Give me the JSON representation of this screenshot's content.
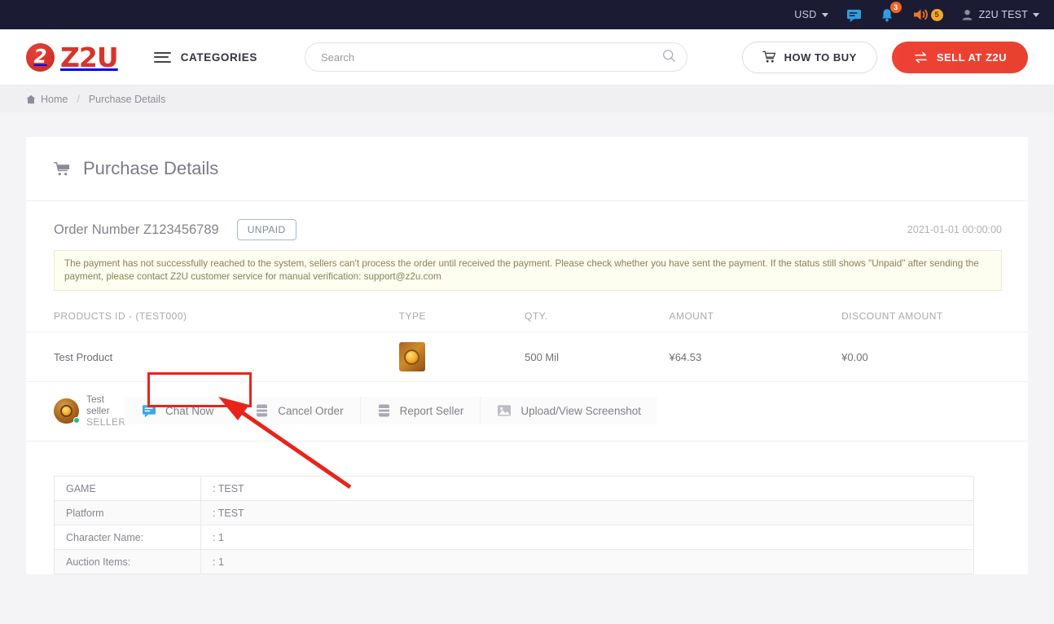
{
  "topbar": {
    "currency": "USD",
    "messages_icon": "message-icon",
    "notifications_count": "3",
    "coin_count": "5",
    "user": "Z2U TEST"
  },
  "header": {
    "logo_mark": "2",
    "logo_text": "Z2U",
    "categories": "CATEGORIES",
    "search_placeholder": "Search",
    "search_value": "",
    "how_to_buy": "HOW TO BUY",
    "sell_at": "SELL AT Z2U"
  },
  "breadcrumb": {
    "home": "Home",
    "separator": "/",
    "current": "Purchase Details"
  },
  "page": {
    "title": "Purchase Details",
    "order_number": "Order Number Z123456789",
    "status_badge": "UNPAID",
    "order_time": "2021-01-01 00:00:00",
    "alert": "The payment has not successfully reached to the system, sellers can't process the order until received the payment. Please check whether you have sent the payment. If the status still shows \"Unpaid\" after sending the payment, please contact Z2U customer service for manual verification: support@z2u.com"
  },
  "products_table": {
    "headers": [
      "PRODUCTS ID - (TEST000)",
      "TYPE",
      "QTY.",
      "AMOUNT",
      "DISCOUNT AMOUNT"
    ],
    "rows": [
      {
        "name": "Test Product",
        "type_icon": "gold-coin-icon",
        "qty": "500 Mil",
        "amount": "¥64.53",
        "discount": "¥0.00"
      }
    ]
  },
  "seller": {
    "name": "Test seller",
    "role": "SELLER",
    "avatar": "seller-avatar"
  },
  "actions": [
    {
      "label": "Chat Now",
      "icon": "chat-icon",
      "highlighted": true
    },
    {
      "label": "Cancel Order",
      "icon": "cancel-order-icon",
      "highlighted": false
    },
    {
      "label": "Report Seller",
      "icon": "report-icon",
      "highlighted": false
    },
    {
      "label": "Upload/View Screenshot",
      "icon": "image-icon",
      "highlighted": false
    }
  ],
  "details": [
    {
      "key": "GAME",
      "value": ": TEST"
    },
    {
      "key": "Platform",
      "value": ": TEST"
    },
    {
      "key": "Character Name:",
      "value": ": 1"
    },
    {
      "key": "Auction Items:",
      "value": ": 1"
    }
  ],
  "colors": {
    "brand_red": "#d8342b",
    "topbar_bg": "#1b1b33",
    "accent_orange": "#f26522",
    "highlight_red": "#e8241a",
    "chat_blue": "#3aa8e8"
  }
}
